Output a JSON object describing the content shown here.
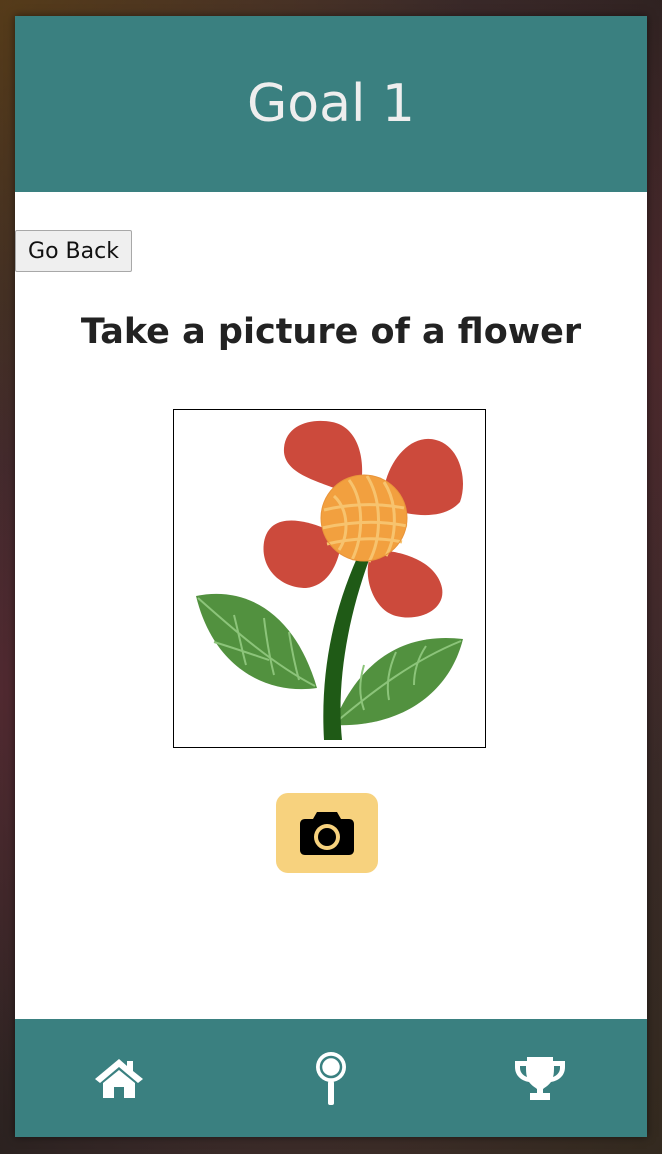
{
  "header": {
    "title": "Goal 1"
  },
  "actions": {
    "back_label": "Go Back"
  },
  "task": {
    "prompt": "Take a picture of a flower",
    "image_subject": "flower-illustration"
  },
  "camera": {
    "icon": "camera-icon",
    "button_color": "#f7d27e"
  },
  "nav": {
    "items": [
      {
        "icon": "home-icon"
      },
      {
        "icon": "magnifier-icon"
      },
      {
        "icon": "trophy-icon"
      }
    ]
  },
  "colors": {
    "brand": "#3a8080",
    "petal": "#cc4a3c",
    "center": "#f2a03f",
    "leaf": "#52913f",
    "stem": "#1f5a16"
  }
}
